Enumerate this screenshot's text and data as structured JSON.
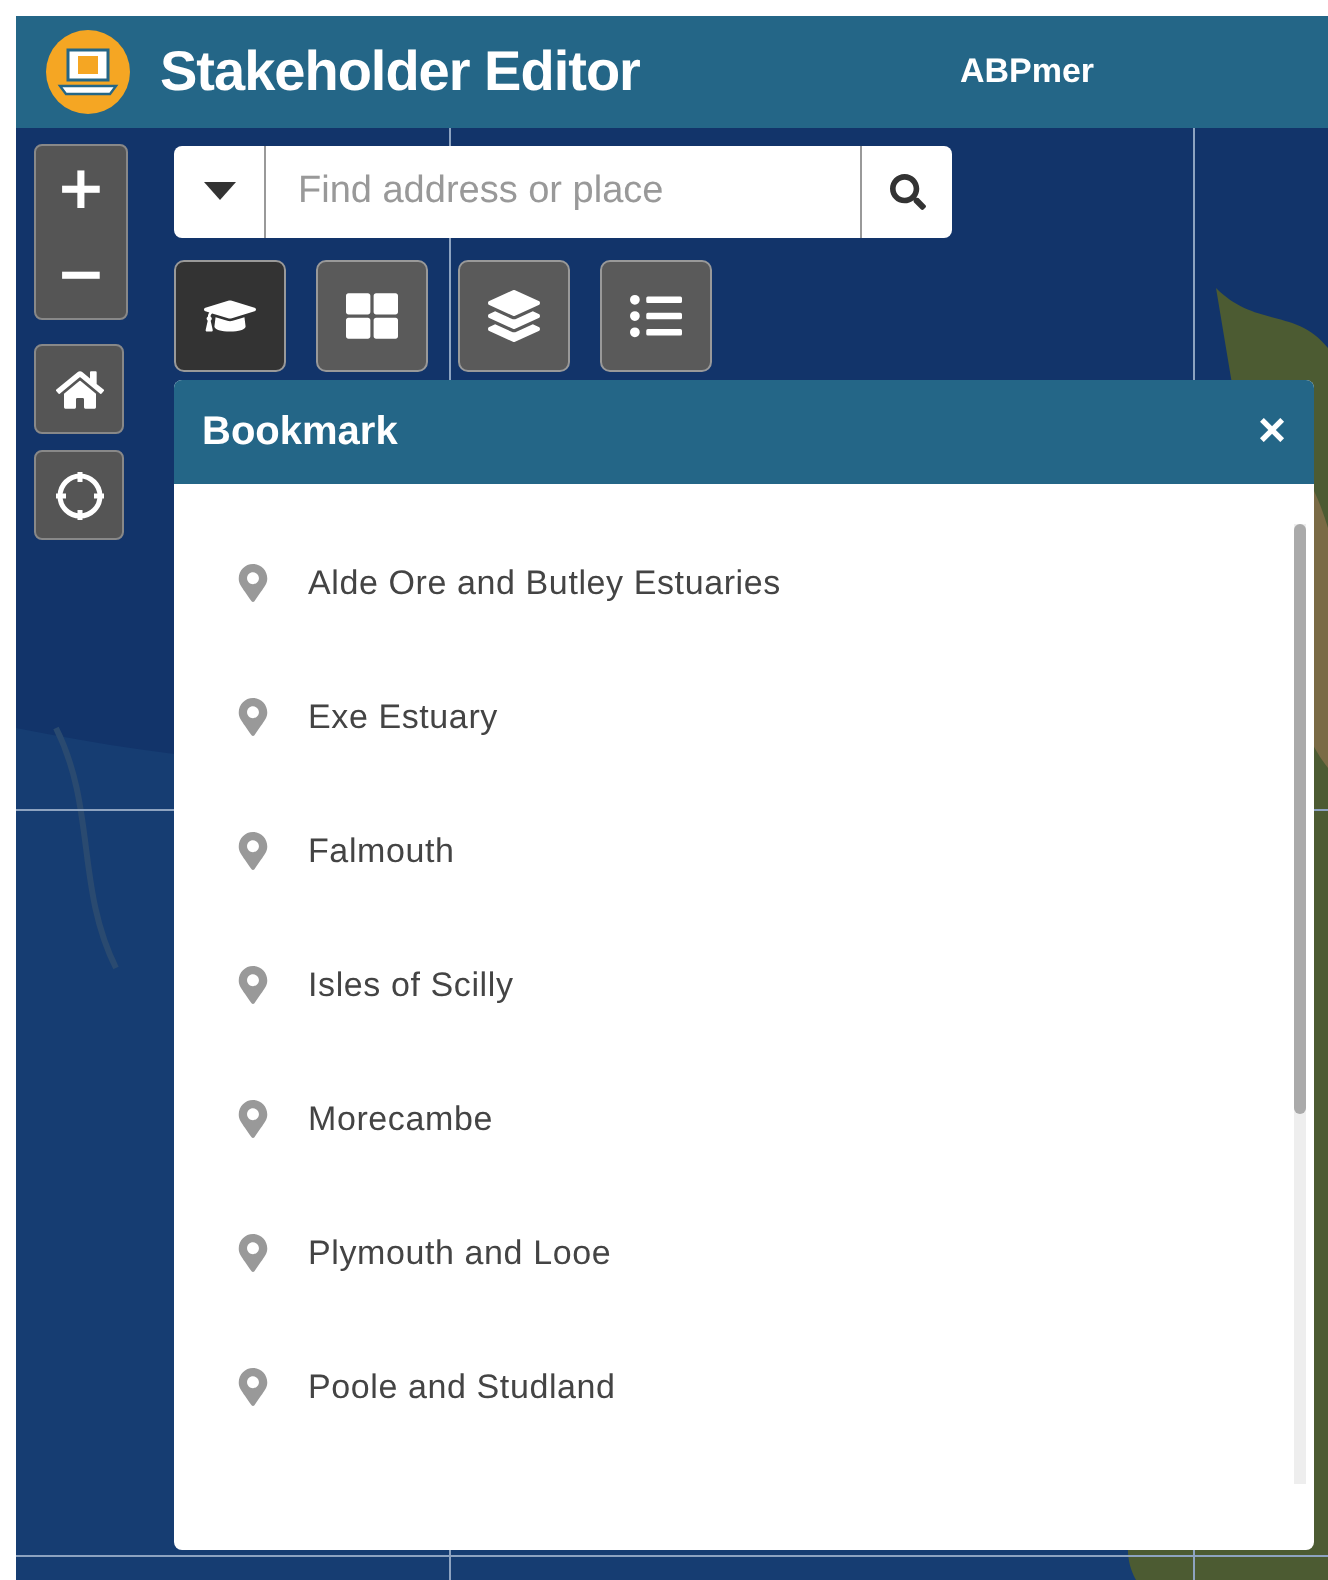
{
  "header": {
    "title": "Stakeholder Editor",
    "user": "ABPmer"
  },
  "search": {
    "placeholder": "Find address or place"
  },
  "tools": [
    {
      "kind": "bookmark",
      "selected": true
    },
    {
      "kind": "grid",
      "selected": false
    },
    {
      "kind": "layers",
      "selected": false
    },
    {
      "kind": "legend",
      "selected": false
    }
  ],
  "map_controls": {
    "zoom_in": "+",
    "zoom_out": "−"
  },
  "panel": {
    "title": "Bookmark",
    "close": "×",
    "items": [
      "Alde Ore and Butley Estuaries",
      "Exe Estuary",
      "Falmouth",
      "Isles of Scilly",
      "Morecambe",
      "Plymouth and Looe",
      "Poole and Studland"
    ]
  }
}
